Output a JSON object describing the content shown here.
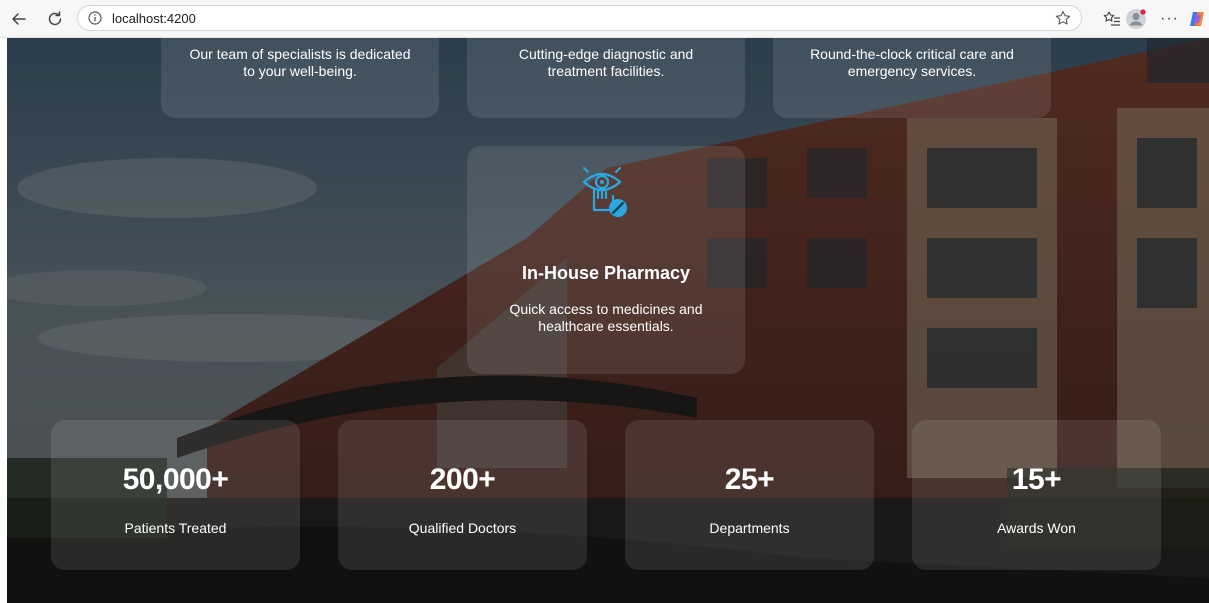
{
  "browser": {
    "url": "localhost:4200"
  },
  "services": [
    {
      "description": "Our team of specialists is dedicated to your well-being."
    },
    {
      "description": "Cutting-edge diagnostic and treatment facilities."
    },
    {
      "description": "Round-the-clock critical care and emergency services."
    }
  ],
  "feature": {
    "icon": "eye-hand-pill-icon",
    "title": "In-House Pharmacy",
    "description": "Quick access to medicines and healthcare essentials."
  },
  "stats": [
    {
      "value": "50,000+",
      "label": "Patients Treated"
    },
    {
      "value": "200+",
      "label": "Qualified Doctors"
    },
    {
      "value": "25+",
      "label": "Departments"
    },
    {
      "value": "15+",
      "label": "Awards Won"
    }
  ],
  "colors": {
    "accent": "#29a9e0",
    "text": "#ffffff"
  }
}
